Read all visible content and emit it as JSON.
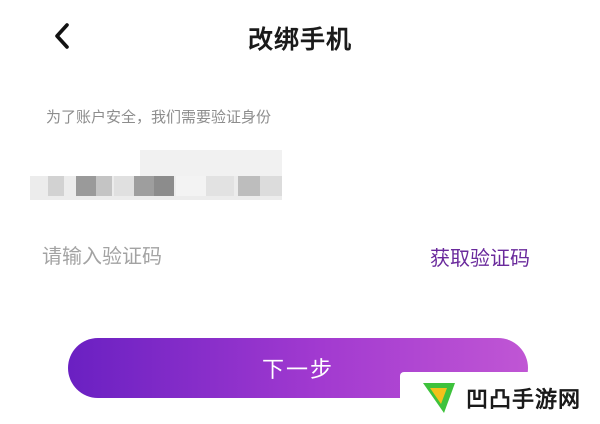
{
  "header": {
    "title": "改绑手机",
    "back_icon": "chevron-left-icon"
  },
  "form": {
    "hint": "为了账户安全，我们需要验证身份",
    "code_placeholder": "请输入验证码",
    "get_code_label": "获取验证码",
    "next_label": "下一步"
  },
  "watermark": {
    "text": "凹凸手游网",
    "logo_icon": "play-triangle-logo"
  },
  "colors": {
    "accent": "#6a2a9c",
    "button_gradient_start": "#6a20c2",
    "button_gradient_end": "#c056d4",
    "logo_green": "#3ec23c"
  }
}
